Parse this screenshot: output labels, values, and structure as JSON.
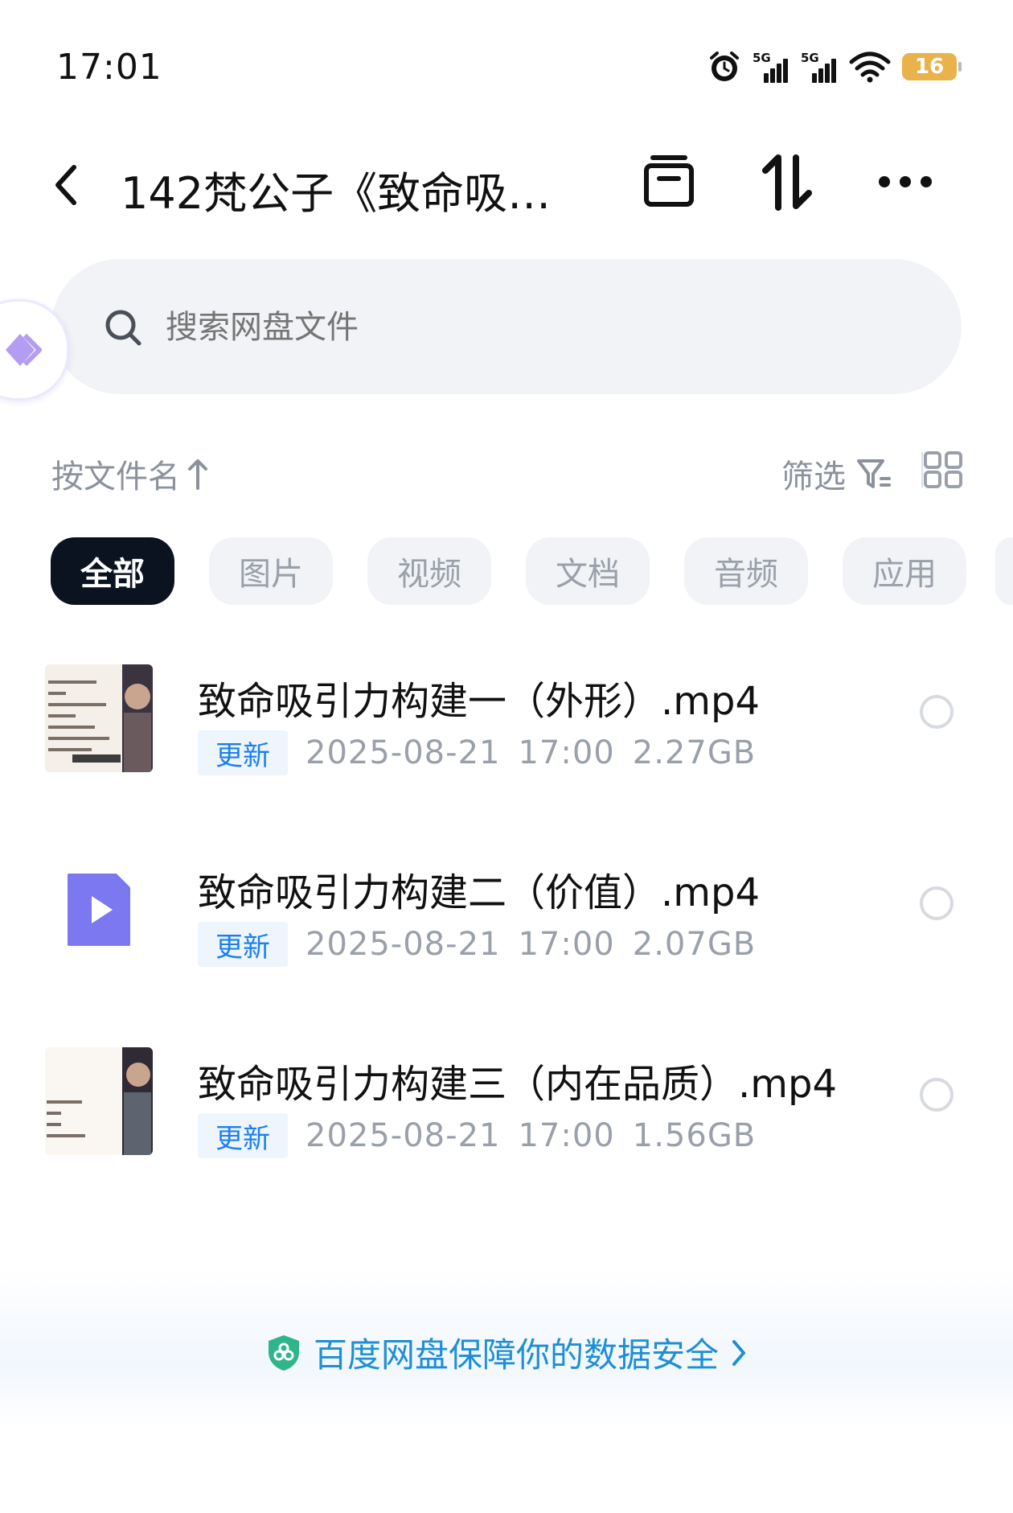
{
  "status_bar": {
    "time": "17:01",
    "signal1_label": "5G",
    "signal2_label": "5G",
    "battery": "16",
    "icons": [
      "alarm-icon",
      "signal-icon",
      "signal-icon",
      "wifi-icon",
      "battery-icon"
    ]
  },
  "header": {
    "title": "142梵公子《致命吸…",
    "icons": [
      "back-icon",
      "archive-icon",
      "transfer-icon",
      "more-icon"
    ]
  },
  "search": {
    "placeholder": "搜索网盘文件"
  },
  "sort": {
    "label": "按文件名",
    "filter_label": "筛选"
  },
  "chips": [
    "全部",
    "图片",
    "视频",
    "文档",
    "音频",
    "应用"
  ],
  "active_chip": "全部",
  "files": [
    {
      "name": "致命吸引力构建一（外形）.mp4",
      "badge": "更新",
      "date": "2025-08-21",
      "time": "17:00",
      "size": "2.27GB",
      "thumb": "video-frame"
    },
    {
      "name": "致命吸引力构建二（价值）.mp4",
      "badge": "更新",
      "date": "2025-08-21",
      "time": "17:00",
      "size": "2.07GB",
      "thumb": "video-file-icon"
    },
    {
      "name": "致命吸引力构建三（内在品质）.mp4",
      "badge": "更新",
      "date": "2025-08-21",
      "time": "17:00",
      "size": "1.56GB",
      "thumb": "video-frame"
    }
  ],
  "footer": {
    "text": "百度网盘保障你的数据安全"
  },
  "colors": {
    "accent": "#1a7ff0",
    "chip_active_bg": "#0b1220",
    "footer_text": "#1e8fd6",
    "video_icon": "#7b78f0"
  }
}
